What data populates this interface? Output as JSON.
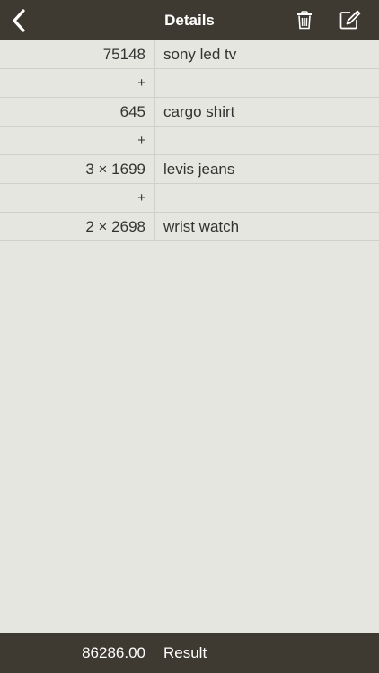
{
  "navbar": {
    "title": "Details",
    "back_icon": "chevron-left-icon",
    "trash_icon": "trash-icon",
    "edit_icon": "edit-icon"
  },
  "rows": [
    {
      "value": "75148",
      "label": "sony led tv"
    },
    {
      "value": "+",
      "label": ""
    },
    {
      "value": "645",
      "label": "cargo shirt"
    },
    {
      "value": "+",
      "label": ""
    },
    {
      "value": "3 × 1699",
      "label": "levis jeans"
    },
    {
      "value": "+",
      "label": ""
    },
    {
      "value": "2 × 2698",
      "label": "wrist watch"
    }
  ],
  "footer": {
    "value": "86286.00",
    "label": "Result"
  },
  "colors": {
    "bar": "#3f3a31",
    "background": "#e5e6df",
    "divider": "#cfd0c9"
  }
}
